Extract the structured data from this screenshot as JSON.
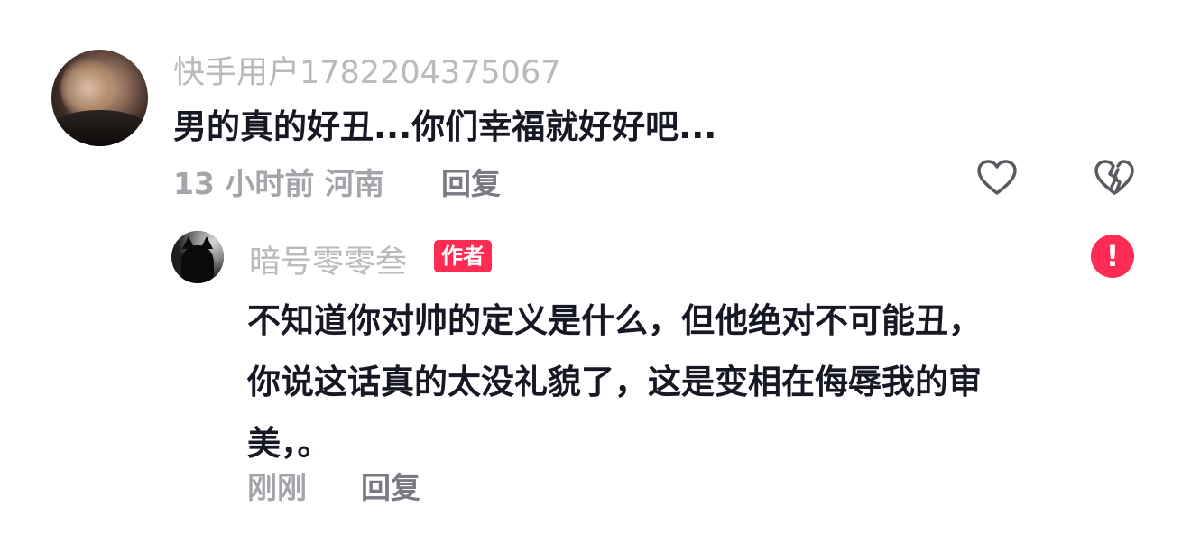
{
  "main_comment": {
    "username": "快手用户1782204375067",
    "text": "男的真的好丑...你们幸福就好好吧...",
    "meta": "13 小时前 河南",
    "reply_label": "回复",
    "like_icon": "heart-outline-icon",
    "dislike_icon": "broken-heart-icon"
  },
  "reply_comment": {
    "username": "暗号零零叁",
    "badge": "作者",
    "alert_icon": "exclamation-icon",
    "alert_glyph": "!",
    "text_lines": [
      "不知道你对帅的定义是什么，但他绝对不可能丑，",
      "你说这话真的太没礼貌了，这是变相在侮辱我的审",
      "美，。"
    ],
    "meta": "刚刚",
    "reply_label": "回复"
  },
  "colors": {
    "accent": "#fe2c55",
    "text_primary": "#161823",
    "text_secondary": "#a4a4aa"
  }
}
